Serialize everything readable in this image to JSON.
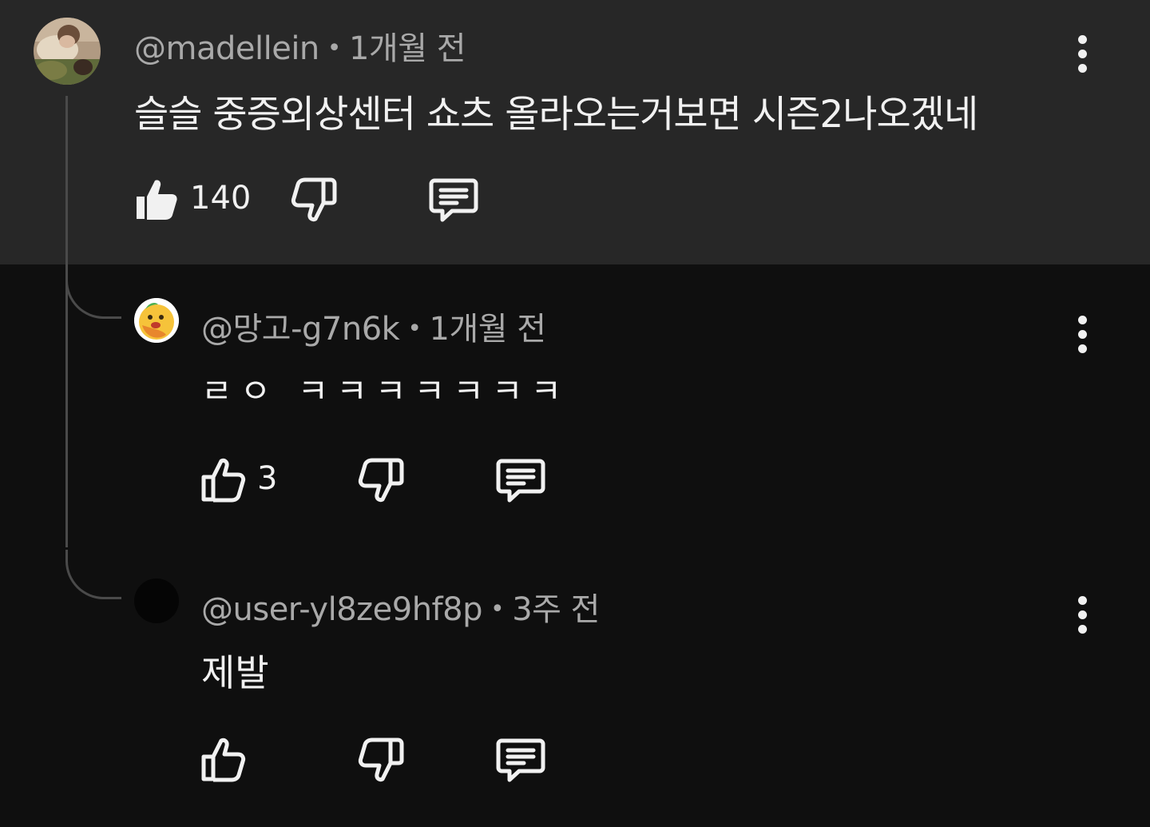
{
  "comment": {
    "author": "@madellein",
    "time": "1개월 전",
    "text": "슬슬 중증외상센터 쇼츠 올라오는거보면 시즌2나오겠네",
    "likes": "140",
    "separator": "•"
  },
  "replies": [
    {
      "author": "@망고-g7n6k",
      "time": "1개월 전",
      "text": "ㄹㅇ ㅋㅋㅋㅋㅋㅋㅋ",
      "likes": "3",
      "separator": "•"
    },
    {
      "author": "@user-yl8ze9hf8p",
      "time": "3주 전",
      "text": "제발",
      "likes": "",
      "separator": "•"
    }
  ],
  "icons": {
    "like": "thumbs-up-icon",
    "dislike": "thumbs-down-icon",
    "reply": "reply-icon",
    "more": "more-vert-icon"
  },
  "colors": {
    "background": "#0f0f0f",
    "highlight": "#272727",
    "text": "#f1f1f1",
    "meta": "#a9a9a9",
    "thread_line": "#4a4a4a"
  }
}
